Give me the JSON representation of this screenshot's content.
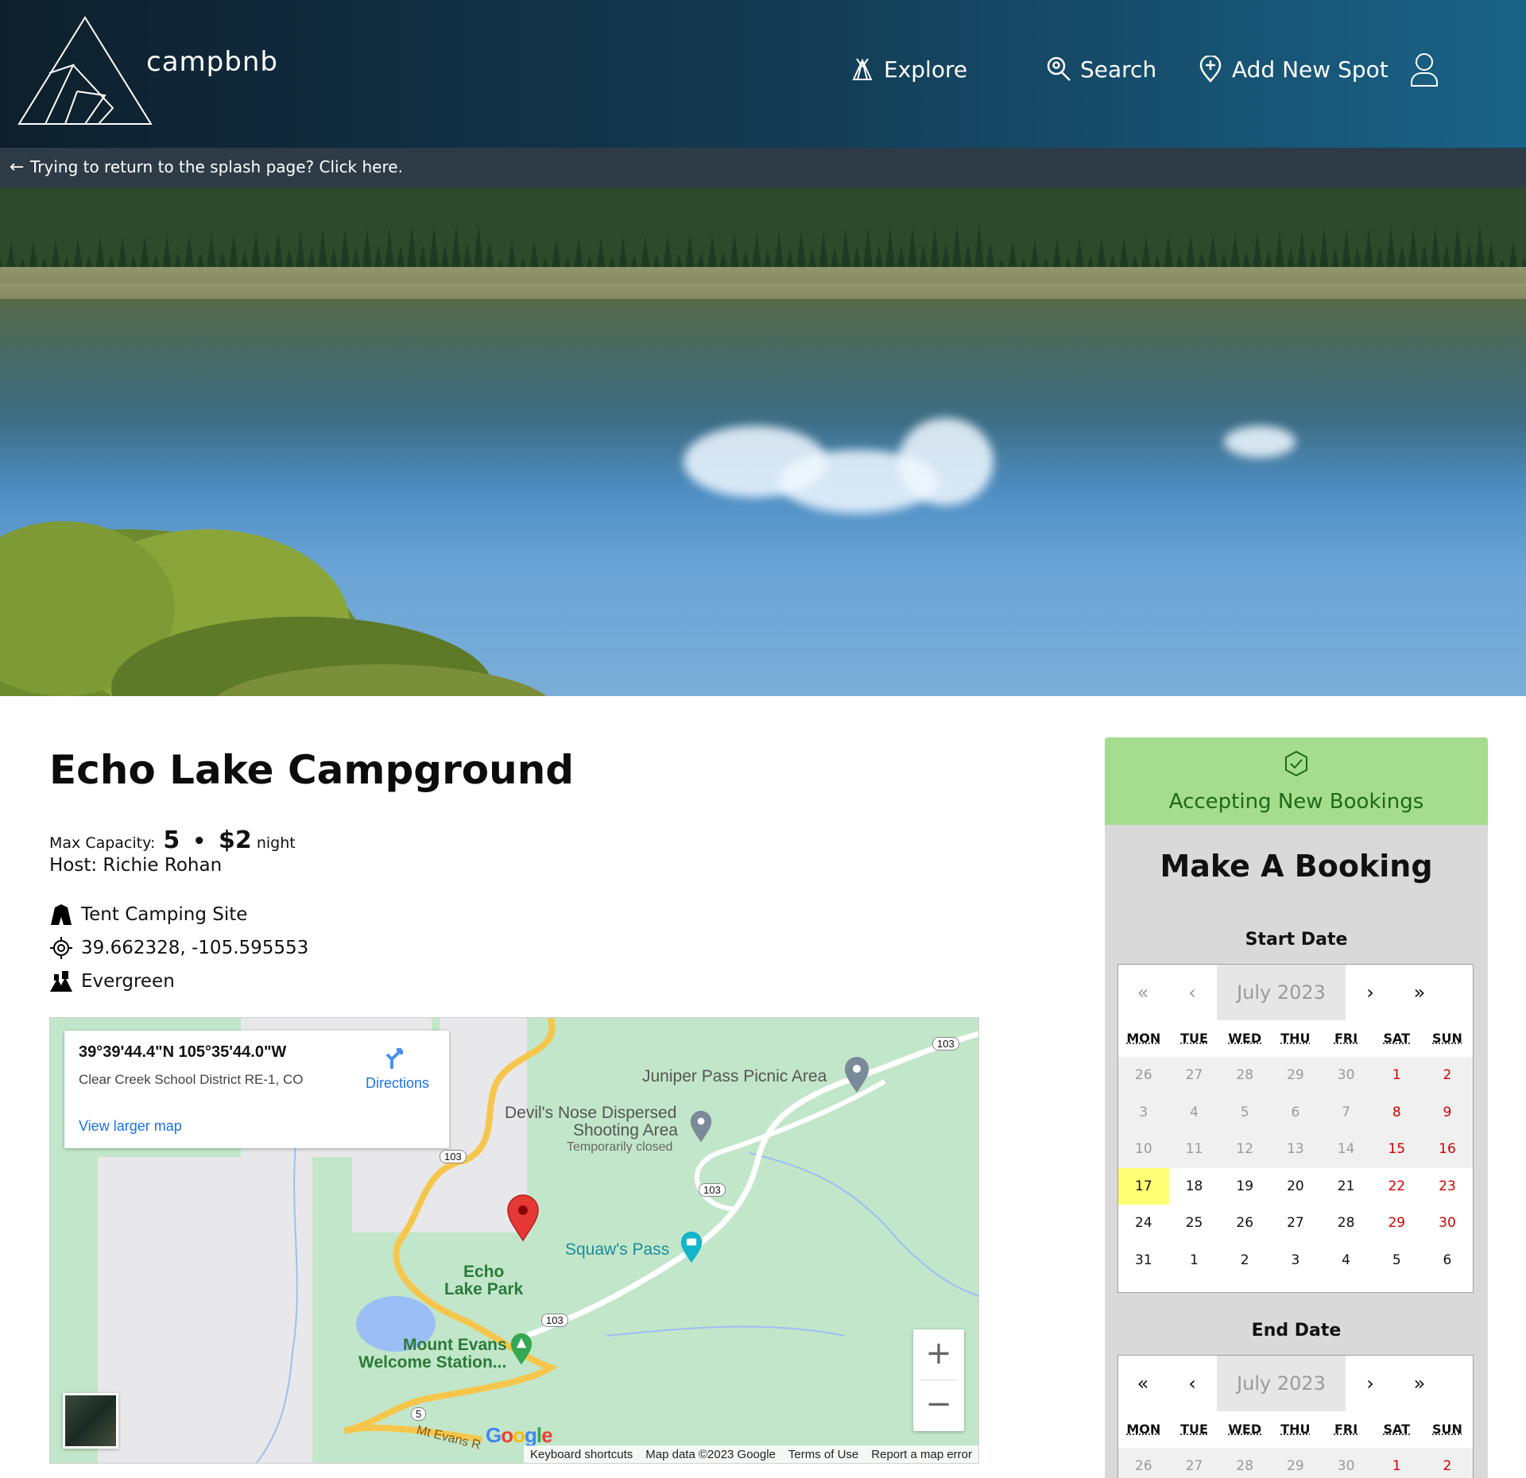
{
  "brand": {
    "name": "campbnb"
  },
  "nav": {
    "explore": "Explore",
    "search": "Search",
    "add_spot": "Add New Spot"
  },
  "return_bar": {
    "arrow": "←",
    "text": "Trying to return to the splash page? Click here."
  },
  "spot": {
    "title": "Echo Lake Campground",
    "capacity_label": "Max Capacity:",
    "capacity": "5",
    "separator": "•",
    "price": "$2",
    "price_unit": "night",
    "host": "Host: Richie Rohan",
    "type": "Tent Camping Site",
    "coordinates": "39.662328, -105.595553",
    "city": "Evergreen"
  },
  "map": {
    "coords_dms": "39°39'44.4\"N 105°35'44.0\"W",
    "district": "Clear Creek School District RE-1, CO",
    "directions": "Directions",
    "view_larger": "View larger map",
    "labels": {
      "juniper": "Juniper Pass Picnic Area",
      "devils_1": "Devil's Nose Dispersed",
      "devils_2": "Shooting Area",
      "devils_3": "Temporarily closed",
      "squaw": "Squaw's Pass",
      "echo_1": "Echo",
      "echo_2": "Lake Park",
      "evans_1": "Mount Evans",
      "evans_2": "Welcome Station...",
      "mtevans": "Mt Evans R",
      "r103a": "103",
      "r103b": "103",
      "r103c": "103",
      "r103d": "103",
      "r5": "5"
    },
    "zoom_in": "+",
    "zoom_out": "−",
    "google": "Google",
    "footer": [
      "Keyboard shortcuts",
      "Map data ©2023 Google",
      "Terms of Use",
      "Report a map error"
    ]
  },
  "booking": {
    "status": "Accepting New Bookings",
    "heading": "Make A Booking",
    "start_label": "Start Date",
    "end_label": "End Date",
    "nav": {
      "prev2": "«",
      "prev": "‹",
      "next": "›",
      "next2": "»"
    },
    "month": "July 2023",
    "weekdays": [
      "MON",
      "TUE",
      "WED",
      "THU",
      "FRI",
      "SAT",
      "SUN"
    ],
    "weeks": [
      [
        "26",
        "27",
        "28",
        "29",
        "30",
        "1",
        "2"
      ],
      [
        "3",
        "4",
        "5",
        "6",
        "7",
        "8",
        "9"
      ],
      [
        "10",
        "11",
        "12",
        "13",
        "14",
        "15",
        "16"
      ],
      [
        "17",
        "18",
        "19",
        "20",
        "21",
        "22",
        "23"
      ],
      [
        "24",
        "25",
        "26",
        "27",
        "28",
        "29",
        "30"
      ],
      [
        "31",
        "1",
        "2",
        "3",
        "4",
        "5",
        "6"
      ]
    ],
    "end_first_row": [
      "26",
      "27",
      "28",
      "29",
      "30",
      "1",
      "2"
    ]
  },
  "colors": {
    "header_start": "#0e1f2c",
    "header_end": "#1a6388",
    "accepting_bg": "#a6dc8d",
    "today": "#ffff76",
    "weekend": "#d10000",
    "link": "#1a73e8"
  }
}
